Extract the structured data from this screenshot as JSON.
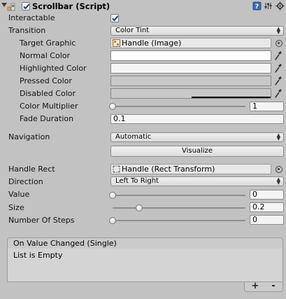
{
  "component": {
    "title": "Scrollbar (Script)",
    "enabled": true
  },
  "fields": {
    "interactable_label": "Interactable",
    "interactable_checked": true,
    "transition_label": "Transition",
    "transition_value": "Color Tint",
    "target_graphic_label": "Target Graphic",
    "target_graphic_value": "Handle (Image)",
    "normal_color_label": "Normal Color",
    "normal_color": "#ffffff",
    "highlighted_color_label": "Highlighted Color",
    "highlighted_color": "#f5f5f5",
    "pressed_color_label": "Pressed Color",
    "pressed_color": "#c8c8c8",
    "disabled_color_label": "Disabled Color",
    "disabled_color": "#c8c8c8",
    "color_multiplier_label": "Color Multiplier",
    "color_multiplier_value": "1",
    "color_multiplier_fraction": 0.0,
    "fade_duration_label": "Fade Duration",
    "fade_duration_value": "0.1",
    "navigation_label": "Navigation",
    "navigation_value": "Automatic",
    "visualize_label": "Visualize",
    "handle_rect_label": "Handle Rect",
    "handle_rect_value": "Handle (Rect Transform)",
    "direction_label": "Direction",
    "direction_value": "Left To Right",
    "value_label": "Value",
    "value_value": "0",
    "value_fraction": 0.0,
    "size_label": "Size",
    "size_value": "0.2",
    "size_fraction": 0.2,
    "steps_label": "Number Of Steps",
    "steps_value": "0",
    "steps_fraction": 0.0
  },
  "event": {
    "header": "On Value Changed (Single)",
    "empty_text": "List is Empty",
    "add_label": "+",
    "remove_label": "-"
  },
  "colors": {
    "panel_bg": "#c2c2c2",
    "check": "#1a3a8a"
  }
}
